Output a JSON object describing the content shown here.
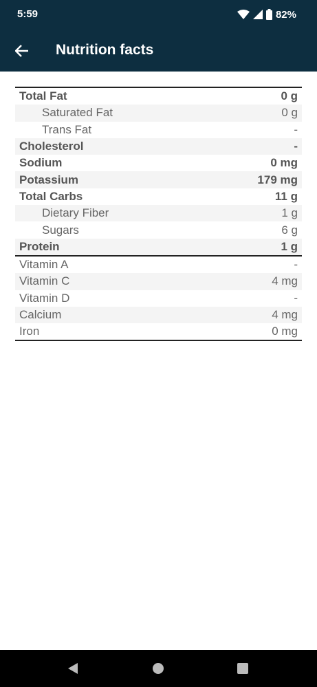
{
  "status": {
    "time": "5:59",
    "battery": "82%"
  },
  "appbar": {
    "title": "Nutrition facts"
  },
  "nutrients": [
    {
      "label": "Total Fat",
      "value": "0 g"
    },
    {
      "label": "Saturated Fat",
      "value": "0 g"
    },
    {
      "label": "Trans Fat",
      "value": "-"
    },
    {
      "label": "Cholesterol",
      "value": "-"
    },
    {
      "label": "Sodium",
      "value": "0 mg"
    },
    {
      "label": "Potassium",
      "value": "179 mg"
    },
    {
      "label": "Total Carbs",
      "value": "11 g"
    },
    {
      "label": "Dietary Fiber",
      "value": "1 g"
    },
    {
      "label": "Sugars",
      "value": "6 g"
    },
    {
      "label": "Protein",
      "value": "1 g"
    }
  ],
  "vitamins": [
    {
      "label": "Vitamin A",
      "value": "-"
    },
    {
      "label": "Vitamin C",
      "value": "4 mg"
    },
    {
      "label": "Vitamin D",
      "value": "-"
    },
    {
      "label": "Calcium",
      "value": "4 mg"
    },
    {
      "label": "Iron",
      "value": "0 mg"
    }
  ]
}
